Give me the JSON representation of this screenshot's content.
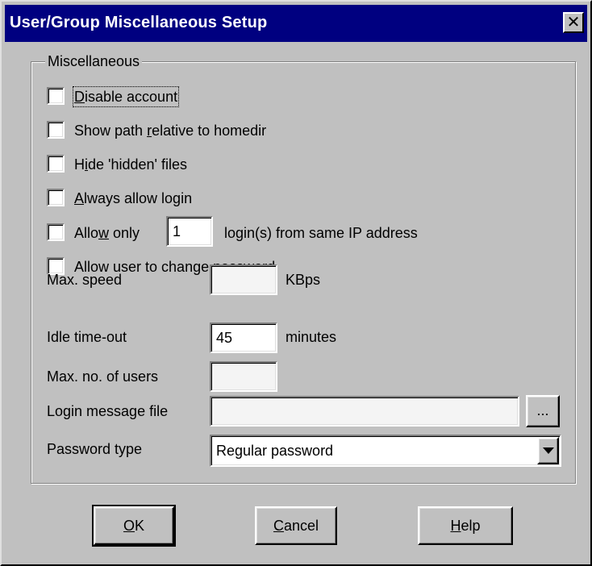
{
  "dialog": {
    "title": "User/Group Miscellaneous Setup",
    "close_glyph": "✕"
  },
  "group": {
    "legend": "Miscellaneous"
  },
  "checkboxes": {
    "disable_account": {
      "pre": "",
      "key": "D",
      "post": "isable account",
      "checked": false
    },
    "show_path": {
      "pre": "Show path ",
      "key": "r",
      "post": "elative to homedir",
      "checked": false
    },
    "hide_hidden": {
      "pre": "H",
      "key": "i",
      "post": "de 'hidden' files",
      "checked": false
    },
    "always_login": {
      "pre": "",
      "key": "A",
      "post": "lways allow login",
      "checked": false
    },
    "allow_only": {
      "pre": "Allo",
      "key": "w",
      "post": " only",
      "checked": false,
      "suffix": "login(s) from same IP address",
      "value": "1"
    },
    "change_password": {
      "pre": "Allow user to change ",
      "key": "p",
      "post": "assword",
      "checked": false
    }
  },
  "fields": {
    "max_speed": {
      "label": "Max. speed",
      "value": "",
      "unit": "KBps"
    },
    "idle_timeout": {
      "label": "Idle time-out",
      "value": "45",
      "unit": "minutes"
    },
    "max_users": {
      "label": "Max. no. of users",
      "value": ""
    },
    "login_message": {
      "label": "Login message file",
      "value": "",
      "browse_label": "..."
    },
    "password_type": {
      "label": "Password type",
      "selected": "Regular password"
    }
  },
  "buttons": {
    "ok": {
      "key": "O",
      "rest": "K"
    },
    "cancel": {
      "key": "C",
      "rest": "ancel"
    },
    "help": {
      "key": "H",
      "rest": "elp"
    }
  },
  "colors": {
    "face": "#c0c0c0",
    "title_bar": "#000080",
    "title_text": "#ffffff"
  }
}
